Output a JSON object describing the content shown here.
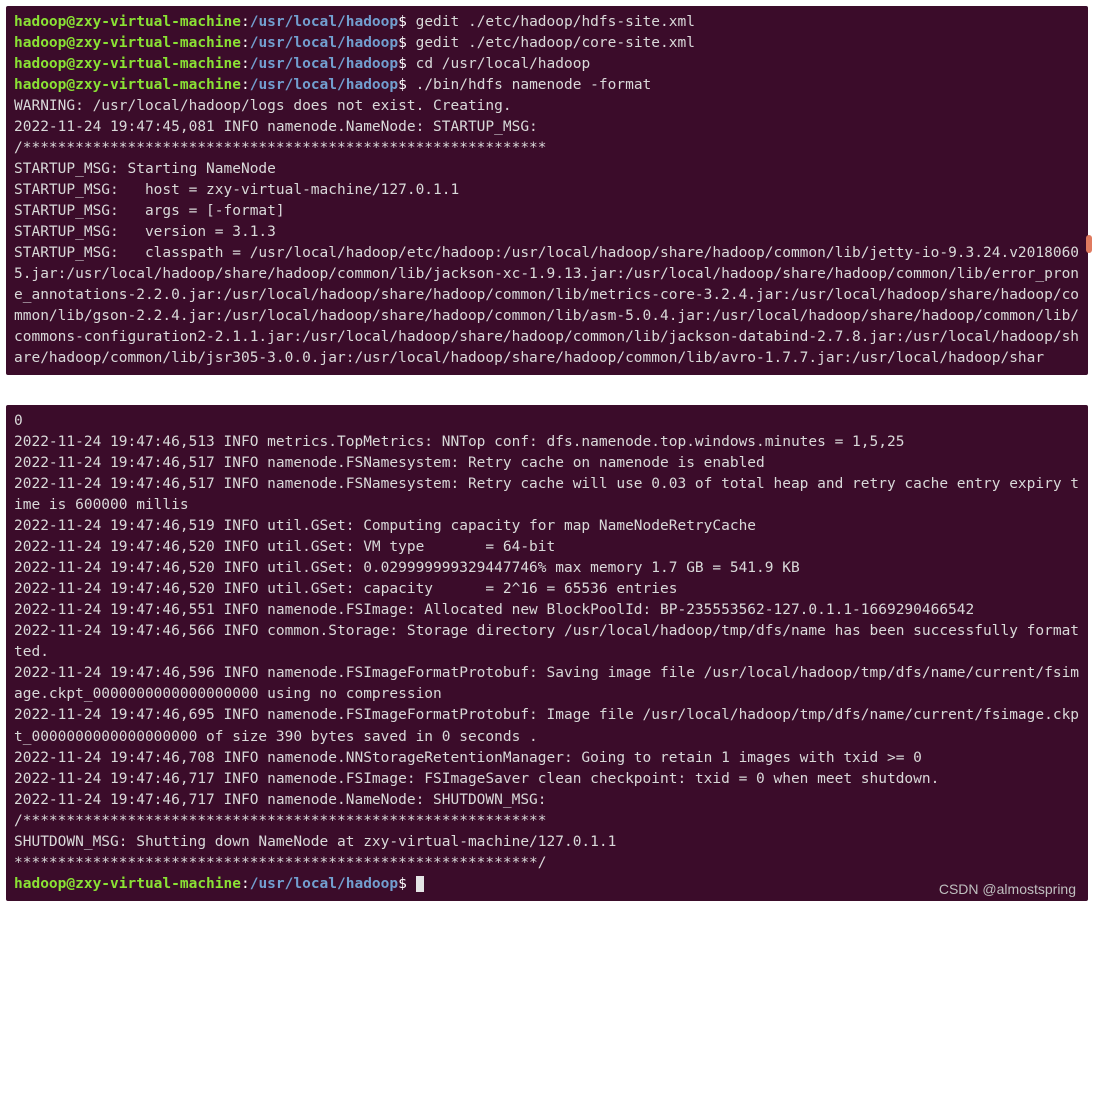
{
  "prompt": {
    "user_host": "hadoop@zxy-virtual-machine",
    "sep": ":",
    "path": "/usr/local/hadoop",
    "suffix": "$"
  },
  "top": {
    "cmd1": " gedit ./etc/hadoop/hdfs-site.xml",
    "cmd2": " gedit ./etc/hadoop/core-site.xml",
    "cmd3": " cd /usr/local/hadoop",
    "cmd4": " ./bin/hdfs namenode -format",
    "out": "WARNING: /usr/local/hadoop/logs does not exist. Creating.\n2022-11-24 19:47:45,081 INFO namenode.NameNode: STARTUP_MSG:\n/************************************************************\nSTARTUP_MSG: Starting NameNode\nSTARTUP_MSG:   host = zxy-virtual-machine/127.0.1.1\nSTARTUP_MSG:   args = [-format]\nSTARTUP_MSG:   version = 3.1.3\nSTARTUP_MSG:   classpath = /usr/local/hadoop/etc/hadoop:/usr/local/hadoop/share/hadoop/common/lib/jetty-io-9.3.24.v20180605.jar:/usr/local/hadoop/share/hadoop/common/lib/jackson-xc-1.9.13.jar:/usr/local/hadoop/share/hadoop/common/lib/error_prone_annotations-2.2.0.jar:/usr/local/hadoop/share/hadoop/common/lib/metrics-core-3.2.4.jar:/usr/local/hadoop/share/hadoop/common/lib/gson-2.2.4.jar:/usr/local/hadoop/share/hadoop/common/lib/asm-5.0.4.jar:/usr/local/hadoop/share/hadoop/common/lib/commons-configuration2-2.1.1.jar:/usr/local/hadoop/share/hadoop/common/lib/jackson-databind-2.7.8.jar:/usr/local/hadoop/share/hadoop/common/lib/jsr305-3.0.0.jar:/usr/local/hadoop/share/hadoop/common/lib/avro-1.7.7.jar:/usr/local/hadoop/shar"
  },
  "bottom": {
    "out": "0\n2022-11-24 19:47:46,513 INFO metrics.TopMetrics: NNTop conf: dfs.namenode.top.windows.minutes = 1,5,25\n2022-11-24 19:47:46,517 INFO namenode.FSNamesystem: Retry cache on namenode is enabled\n2022-11-24 19:47:46,517 INFO namenode.FSNamesystem: Retry cache will use 0.03 of total heap and retry cache entry expiry time is 600000 millis\n2022-11-24 19:47:46,519 INFO util.GSet: Computing capacity for map NameNodeRetryCache\n2022-11-24 19:47:46,520 INFO util.GSet: VM type       = 64-bit\n2022-11-24 19:47:46,520 INFO util.GSet: 0.029999999329447746% max memory 1.7 GB = 541.9 KB\n2022-11-24 19:47:46,520 INFO util.GSet: capacity      = 2^16 = 65536 entries\n2022-11-24 19:47:46,551 INFO namenode.FSImage: Allocated new BlockPoolId: BP-235553562-127.0.1.1-1669290466542\n2022-11-24 19:47:46,566 INFO common.Storage: Storage directory /usr/local/hadoop/tmp/dfs/name has been successfully formatted.\n2022-11-24 19:47:46,596 INFO namenode.FSImageFormatProtobuf: Saving image file /usr/local/hadoop/tmp/dfs/name/current/fsimage.ckpt_0000000000000000000 using no compression\n2022-11-24 19:47:46,695 INFO namenode.FSImageFormatProtobuf: Image file /usr/local/hadoop/tmp/dfs/name/current/fsimage.ckpt_0000000000000000000 of size 390 bytes saved in 0 seconds .\n2022-11-24 19:47:46,708 INFO namenode.NNStorageRetentionManager: Going to retain 1 images with txid >= 0\n2022-11-24 19:47:46,717 INFO namenode.FSImage: FSImageSaver clean checkpoint: txid = 0 when meet shutdown.\n2022-11-24 19:47:46,717 INFO namenode.NameNode: SHUTDOWN_MSG:\n/************************************************************\nSHUTDOWN_MSG: Shutting down NameNode at zxy-virtual-machine/127.0.1.1\n************************************************************/"
  },
  "watermark": "CSDN @almostspring"
}
